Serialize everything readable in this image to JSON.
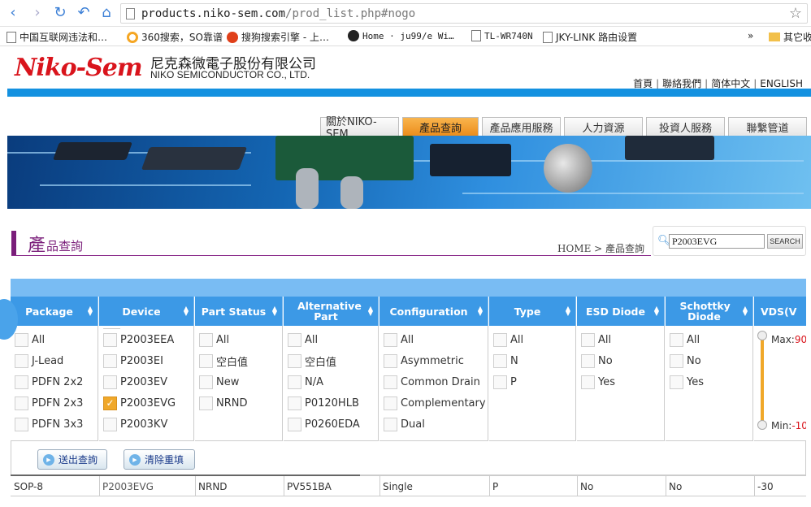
{
  "browser": {
    "url_host": "products.niko-sem.com",
    "url_path": "/prod_list.php#nogo",
    "bookmarks": [
      "中国互联网违法和…",
      "360搜索，SO靠谱",
      "搜狗搜索引擎 - 上…",
      "Home · ju99/e Wi…",
      "TL-WR740N",
      "JKY-LINK 路由设置"
    ],
    "more_label": "»",
    "other_folder": "其它收藏"
  },
  "header": {
    "logo_text": "Niko-Sem",
    "company_cn": "尼克森微電子股份有限公司",
    "company_en": "NIKO SEMICONDUCTOR CO., LTD.",
    "top_links": [
      "首頁",
      "聯絡我們",
      "简体中文",
      "ENGLISH"
    ],
    "link_sep": "|"
  },
  "tabs": [
    {
      "label": "關於NIKO-SEM",
      "active": false
    },
    {
      "label": "產品查詢",
      "active": true
    },
    {
      "label": "產品應用服務",
      "active": false
    },
    {
      "label": "人力資源",
      "active": false
    },
    {
      "label": "投資人服務",
      "active": false
    },
    {
      "label": "聯繫管道",
      "active": false
    }
  ],
  "page": {
    "title_big": "產",
    "title_small": "品查詢",
    "breadcrumb": "HOME > 產品查詢"
  },
  "search": {
    "value": "P2003EVG",
    "button": "SEARCH"
  },
  "filters": {
    "package": {
      "header": "Package",
      "options": [
        "All",
        "J-Lead",
        "PDFN 2x2",
        "PDFN 2x3",
        "PDFN 3x3"
      ]
    },
    "device": {
      "header": "Device",
      "options": [
        "P2003EEA",
        "P2003EI",
        "P2003EV",
        "P2003EVG",
        "P2003KV"
      ],
      "checked": "P2003EVG"
    },
    "part_status": {
      "header": "Part Status",
      "options": [
        "All",
        "空白值",
        "New",
        "NRND"
      ]
    },
    "alternative_part": {
      "header": "Alternative Part",
      "options": [
        "All",
        "空白值",
        "N/A",
        "P0120HLB",
        "P0260EDA"
      ]
    },
    "configuration": {
      "header": "Configuration",
      "options": [
        "All",
        "Asymmetric",
        "Common Drain",
        "Complementary",
        "Dual"
      ]
    },
    "type": {
      "header": "Type",
      "options": [
        "All",
        "N",
        "P"
      ]
    },
    "esd_diode": {
      "header": "ESD Diode",
      "options": [
        "All",
        "No",
        "Yes"
      ]
    },
    "schottky_diode": {
      "header": "Schottky Diode",
      "options": [
        "All",
        "No",
        "Yes"
      ]
    },
    "vds": {
      "header": "VDS(V",
      "max_label": "Max:",
      "max_value": "90",
      "min_label": "Min:",
      "min_value": "-10"
    }
  },
  "actions": {
    "submit": "送出查詢",
    "reset": "清除重填"
  },
  "result_row": [
    "SOP-8",
    "P2003EVG",
    "NRND",
    "PV551BA",
    "Single",
    "P",
    "No",
    "No",
    "-30"
  ],
  "colors": {
    "brand_red": "#d9141c",
    "accent_blue": "#1491e0",
    "header_blue": "#3c99e6",
    "tab_active": "#ec8d1c",
    "title_purple": "#7a1e7a"
  }
}
